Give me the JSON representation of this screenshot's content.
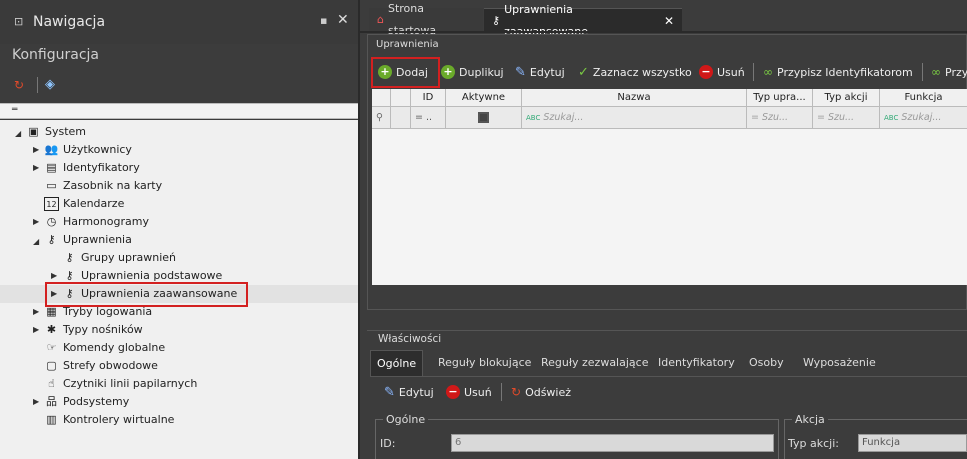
{
  "nav": {
    "title": "Nawigacja",
    "section": "Konfiguracja"
  },
  "tree": {
    "root": "System",
    "items": [
      {
        "label": "Użytkownicy"
      },
      {
        "label": "Identyfikatory"
      },
      {
        "label": "Zasobnik na karty"
      },
      {
        "label": "Kalendarze"
      },
      {
        "label": "Harmonogramy"
      },
      {
        "label": "Uprawnienia"
      },
      {
        "label": "Grupy uprawnień"
      },
      {
        "label": "Uprawnienia podstawowe"
      },
      {
        "label": "Uprawnienia zaawansowane"
      },
      {
        "label": "Tryby logowania"
      },
      {
        "label": "Typy nośników"
      },
      {
        "label": "Komendy globalne"
      },
      {
        "label": "Strefy obwodowe"
      },
      {
        "label": "Czytniki linii papilarnych"
      },
      {
        "label": "Podsystemy"
      },
      {
        "label": "Kontrolery wirtualne"
      }
    ]
  },
  "tabs": [
    {
      "label": "Strona startowa"
    },
    {
      "label": "Uprawnienia zaawansowane"
    }
  ],
  "permissions": {
    "group_title": "Uprawnienia",
    "toolbar": {
      "add": "Dodaj",
      "duplicate": "Duplikuj",
      "edit": "Edytuj",
      "select_all": "Zaznacz wszystko",
      "delete": "Usuń",
      "assign_ids": "Przypisz Identyfikatorom",
      "assign_cut": "Przy"
    },
    "columns": [
      "ID",
      "Aktywne",
      "Nazwa",
      "Typ upra...",
      "Typ akcji",
      "Funkcja"
    ],
    "filter": {
      "id": "= ..",
      "name": "Szukaj...",
      "perm_type": "= Szu...",
      "action_type": "= Szu...",
      "function": "Szukaj..."
    }
  },
  "properties": {
    "group_title": "Właściwości",
    "tabs": [
      "Ogólne",
      "Reguły blokujące",
      "Reguły zezwalające",
      "Identyfikatory",
      "Osoby",
      "Wyposażenie"
    ],
    "toolbar": {
      "edit": "Edytuj",
      "delete": "Usuń",
      "refresh": "Odśwież"
    },
    "general": {
      "title": "Ogólne",
      "id_label": "ID:",
      "id_value": "6"
    },
    "action": {
      "title": "Akcja",
      "type_label": "Typ akcji:",
      "type_value": "Funkcja"
    }
  },
  "colors": {
    "highlight": "#d32020",
    "add_green": "#6aaa2a",
    "delete_red": "#d01818"
  }
}
